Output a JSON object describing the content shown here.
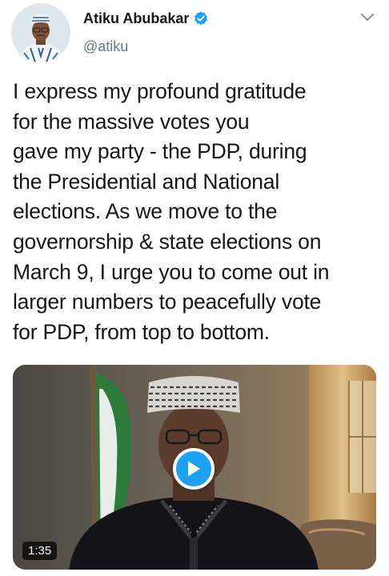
{
  "author": {
    "display_name": "Atiku Abubakar",
    "handle": "@atiku",
    "verified": true,
    "verified_color": "#1da1f2"
  },
  "tweet": {
    "text": "I express my profound gratitude\nfor the massive votes you\ngave my party - the PDP, during\nthe Presidential and National\nelections. As we move to the\ngovernorship & state elections on\nMarch 9, I urge you to come out in\nlarger numbers to peacefully vote\nfor PDP, from top to bottom."
  },
  "media": {
    "type": "video",
    "duration": "1:35",
    "play_icon": "play-icon",
    "play_color": "#1da1f2"
  },
  "icons": {
    "menu": "chevron-down-icon",
    "verified": "verified-badge-icon"
  }
}
